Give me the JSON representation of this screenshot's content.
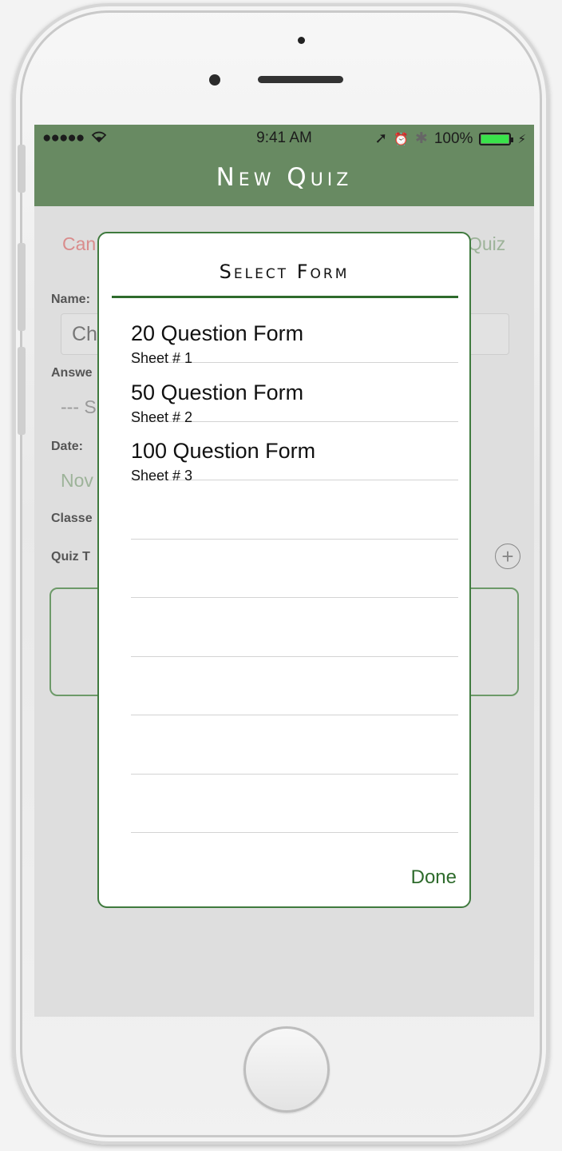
{
  "status_bar": {
    "signal": "●●●●●",
    "wifi": "wifi-icon",
    "time": "9:41 AM",
    "location": "➚",
    "alarm": "⏰",
    "bluetooth": "✱",
    "battery_percent": "100%",
    "battery_level": 1.0
  },
  "nav": {
    "title": "New Quiz"
  },
  "background_form": {
    "cancel_label": "Can",
    "save_label": "Quiz",
    "name_label": "Name:",
    "name_value": "Ch",
    "answer_label": "Answe",
    "answer_value": "--- S",
    "date_label": "Date:",
    "date_value": "Nov",
    "classes_label": "Classe",
    "quiz_type_label": "Quiz T",
    "add_symbol": "+"
  },
  "modal": {
    "title": "Select Form",
    "items": [
      {
        "title": "20 Question Form",
        "subtitle": "Sheet # 1"
      },
      {
        "title": "50 Question Form",
        "subtitle": "Sheet # 2"
      },
      {
        "title": "100 Question Form",
        "subtitle": "Sheet # 3"
      },
      {
        "title": "",
        "subtitle": ""
      },
      {
        "title": "",
        "subtitle": ""
      },
      {
        "title": "",
        "subtitle": ""
      },
      {
        "title": "",
        "subtitle": ""
      },
      {
        "title": "",
        "subtitle": ""
      },
      {
        "title": "",
        "subtitle": ""
      }
    ],
    "done_label": "Done"
  },
  "colors": {
    "nav_green": "#688a62",
    "accent_green": "#2e6b2c",
    "cancel_red": "#d98c8c",
    "battery_green": "#39e34a"
  }
}
